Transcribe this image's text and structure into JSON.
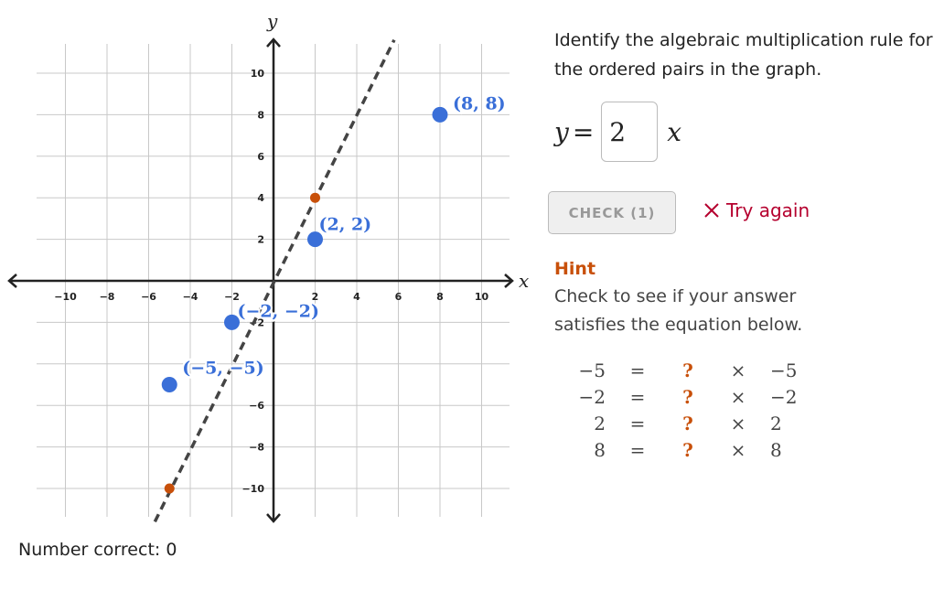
{
  "graph": {
    "x_label": "x",
    "y_label": "y",
    "x_ticks": [
      "−10",
      "−8",
      "−6",
      "−4",
      "−2",
      "2",
      "4",
      "6",
      "8",
      "10"
    ],
    "x_tick_values": [
      -10,
      -8,
      -6,
      -4,
      -2,
      2,
      4,
      6,
      8,
      10
    ],
    "y_ticks": [
      "10",
      "8",
      "6",
      "4",
      "2",
      "−2",
      "−6",
      "−8",
      "−10"
    ],
    "y_tick_values": [
      10,
      8,
      6,
      4,
      2,
      -2,
      -6,
      -8,
      -10
    ],
    "range": {
      "x": [
        -11.3,
        11.3
      ],
      "y": [
        -11.4,
        11.4
      ]
    },
    "points": [
      {
        "x": -5,
        "y": -5,
        "label": "(−5, −5)"
      },
      {
        "x": -2,
        "y": -2,
        "label": "(−2, −2)"
      },
      {
        "x": 2,
        "y": 2,
        "label": "(2, 2)"
      },
      {
        "x": 8,
        "y": 8,
        "label": "(8, 8)"
      }
    ],
    "guess_line": {
      "slope": 2,
      "points": [
        {
          "x": 2,
          "y": 4
        },
        {
          "x": -5,
          "y": -10
        }
      ]
    },
    "colors": {
      "points": "#3a6fd8",
      "guess": "#c8500a",
      "line": "#444444",
      "grid": "#c8c8c8",
      "axis": "#222222"
    }
  },
  "prompt": "Identify the algebraic multiplication rule for the ordered pairs in the graph.",
  "equation": {
    "lhs": "y",
    "equals": "=",
    "value": "2",
    "rhs": "x"
  },
  "check_button": "CHECK (1)",
  "feedback": {
    "icon": "x-icon",
    "text": "Try again",
    "color": "#b5002e"
  },
  "hint": {
    "title": "Hint",
    "text": "Check to see if your answer satisfies the equation below.",
    "rows": [
      {
        "y": "−5",
        "eq": "=",
        "q": "?",
        "times": "×",
        "x": "−5"
      },
      {
        "y": "−2",
        "eq": "=",
        "q": "?",
        "times": "×",
        "x": "−2"
      },
      {
        "y": "2",
        "eq": "=",
        "q": "?",
        "times": "×",
        "x": "2"
      },
      {
        "y": "8",
        "eq": "=",
        "q": "?",
        "times": "×",
        "x": "8"
      }
    ]
  },
  "score": "Number correct: 0"
}
